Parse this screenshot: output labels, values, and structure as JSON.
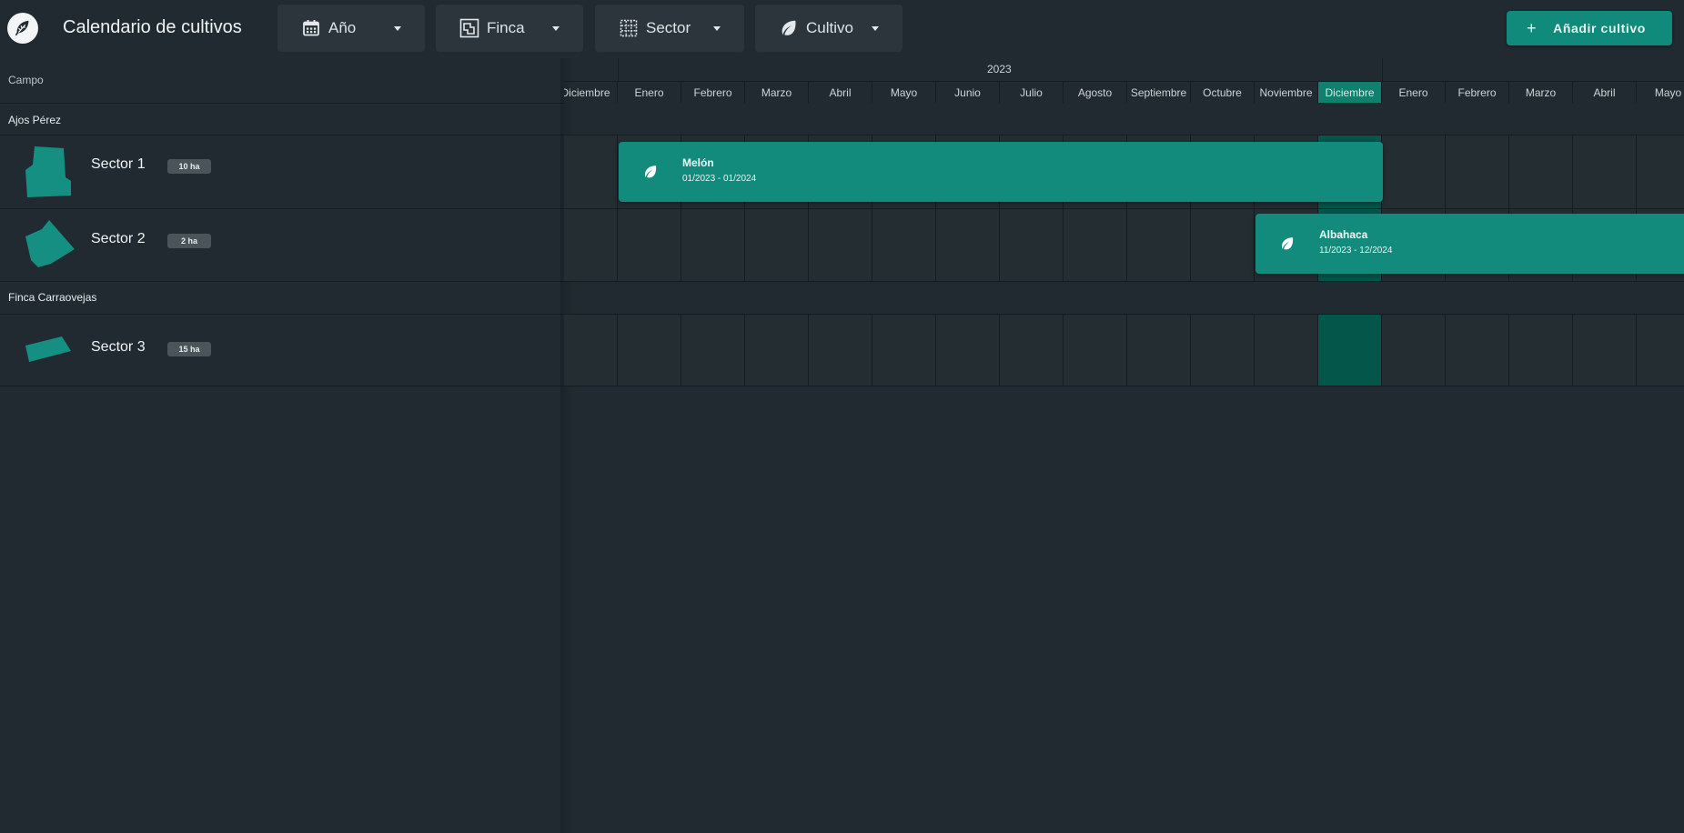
{
  "app": {
    "title": "Calendario de cultivos",
    "logo_icon": "leaf-logo-icon"
  },
  "filters": [
    {
      "label": "Año",
      "icon": "calendar-icon"
    },
    {
      "label": "Finca",
      "icon": "map-icon"
    },
    {
      "label": "Sector",
      "icon": "grid-icon"
    },
    {
      "label": "Cultivo",
      "icon": "leaf-icon"
    }
  ],
  "add_button": {
    "label": "Añadir cultivo",
    "icon": "plus-icon"
  },
  "colors": {
    "accent": "#128b7c",
    "current_month": "#04564a",
    "background": "#212a30"
  },
  "left_header": "Campo",
  "timeline": {
    "year_label": "2023",
    "months": [
      "Diciembre",
      "Enero",
      "Febrero",
      "Marzo",
      "Abril",
      "Mayo",
      "Junio",
      "Julio",
      "Agosto",
      "Septiembre",
      "Octubre",
      "Noviembre",
      "Diciembre",
      "Enero",
      "Febrero",
      "Marzo",
      "Abril",
      "Mayo"
    ],
    "current_month_index": 12
  },
  "groups": [
    {
      "name": "Ajos Pérez",
      "sectors": [
        {
          "name": "Sector 1",
          "area": "10 ha"
        },
        {
          "name": "Sector 2",
          "area": "2 ha"
        }
      ]
    },
    {
      "name": "Finca Carraovejas",
      "sectors": [
        {
          "name": "Sector 3",
          "area": "15 ha"
        }
      ]
    }
  ],
  "crops": [
    {
      "name": "Melón",
      "dates": "01/2023 - 01/2024",
      "icon": "leaf-icon"
    },
    {
      "name": "Albahaca",
      "dates": "11/2023 - 12/2024",
      "icon": "leaf-icon"
    }
  ]
}
